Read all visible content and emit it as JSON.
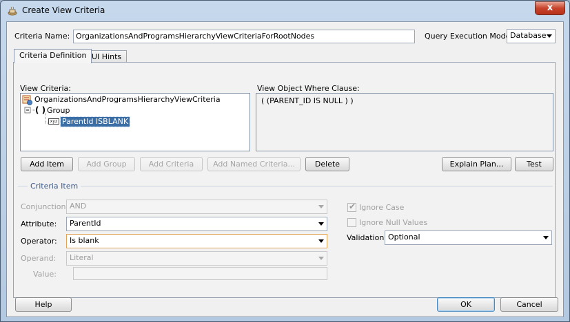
{
  "window": {
    "title": "Create View Criteria",
    "close_glyph": "x"
  },
  "criteria_name": {
    "label": "Criteria Name:",
    "value": "OrganizationsAndProgramsHierarchyViewCriteriaForRootNodes"
  },
  "query_mode": {
    "label": "Query Execution Mode:",
    "value": "Database"
  },
  "tabs": [
    {
      "label": "Criteria Definition",
      "active": true
    },
    {
      "label": "UI Hints",
      "active": false
    }
  ],
  "view_criteria": {
    "label": "View Criteria:",
    "tree": {
      "root": "OrganizationsAndProgramsHierarchyViewCriteria",
      "group": "Group",
      "group_glyph": "( )",
      "item": "ParentId ISBLANK",
      "item_icon_text": "xyz"
    }
  },
  "where_clause": {
    "label": "View Object Where Clause:",
    "text": "( (PARENT_ID IS NULL ) )"
  },
  "buttons": {
    "add_item": "Add Item",
    "add_group": "Add Group",
    "add_criteria": "Add Criteria",
    "add_named_criteria": "Add Named Criteria...",
    "delete": "Delete",
    "explain_plan": "Explain Plan...",
    "test": "Test",
    "help": "Help",
    "ok": "OK",
    "cancel": "Cancel"
  },
  "criteria_item": {
    "section_label": "Criteria Item",
    "conjunction": {
      "label": "Conjunction:",
      "value": "AND"
    },
    "attribute": {
      "label": "Attribute:",
      "value": "ParentId"
    },
    "operator": {
      "label": "Operator:",
      "value": "Is blank"
    },
    "operand": {
      "label": "Operand:",
      "value": "Literal"
    },
    "value": {
      "label": "Value:",
      "value": ""
    },
    "ignore_case": {
      "label": "Ignore Case",
      "checked": true
    },
    "ignore_null": {
      "label": "Ignore Null Values",
      "checked": false
    },
    "validation": {
      "label": "Validation:",
      "value": "Optional"
    }
  },
  "colors": {
    "selection": "#3a6ea5",
    "section_label": "#3c5a8a"
  }
}
